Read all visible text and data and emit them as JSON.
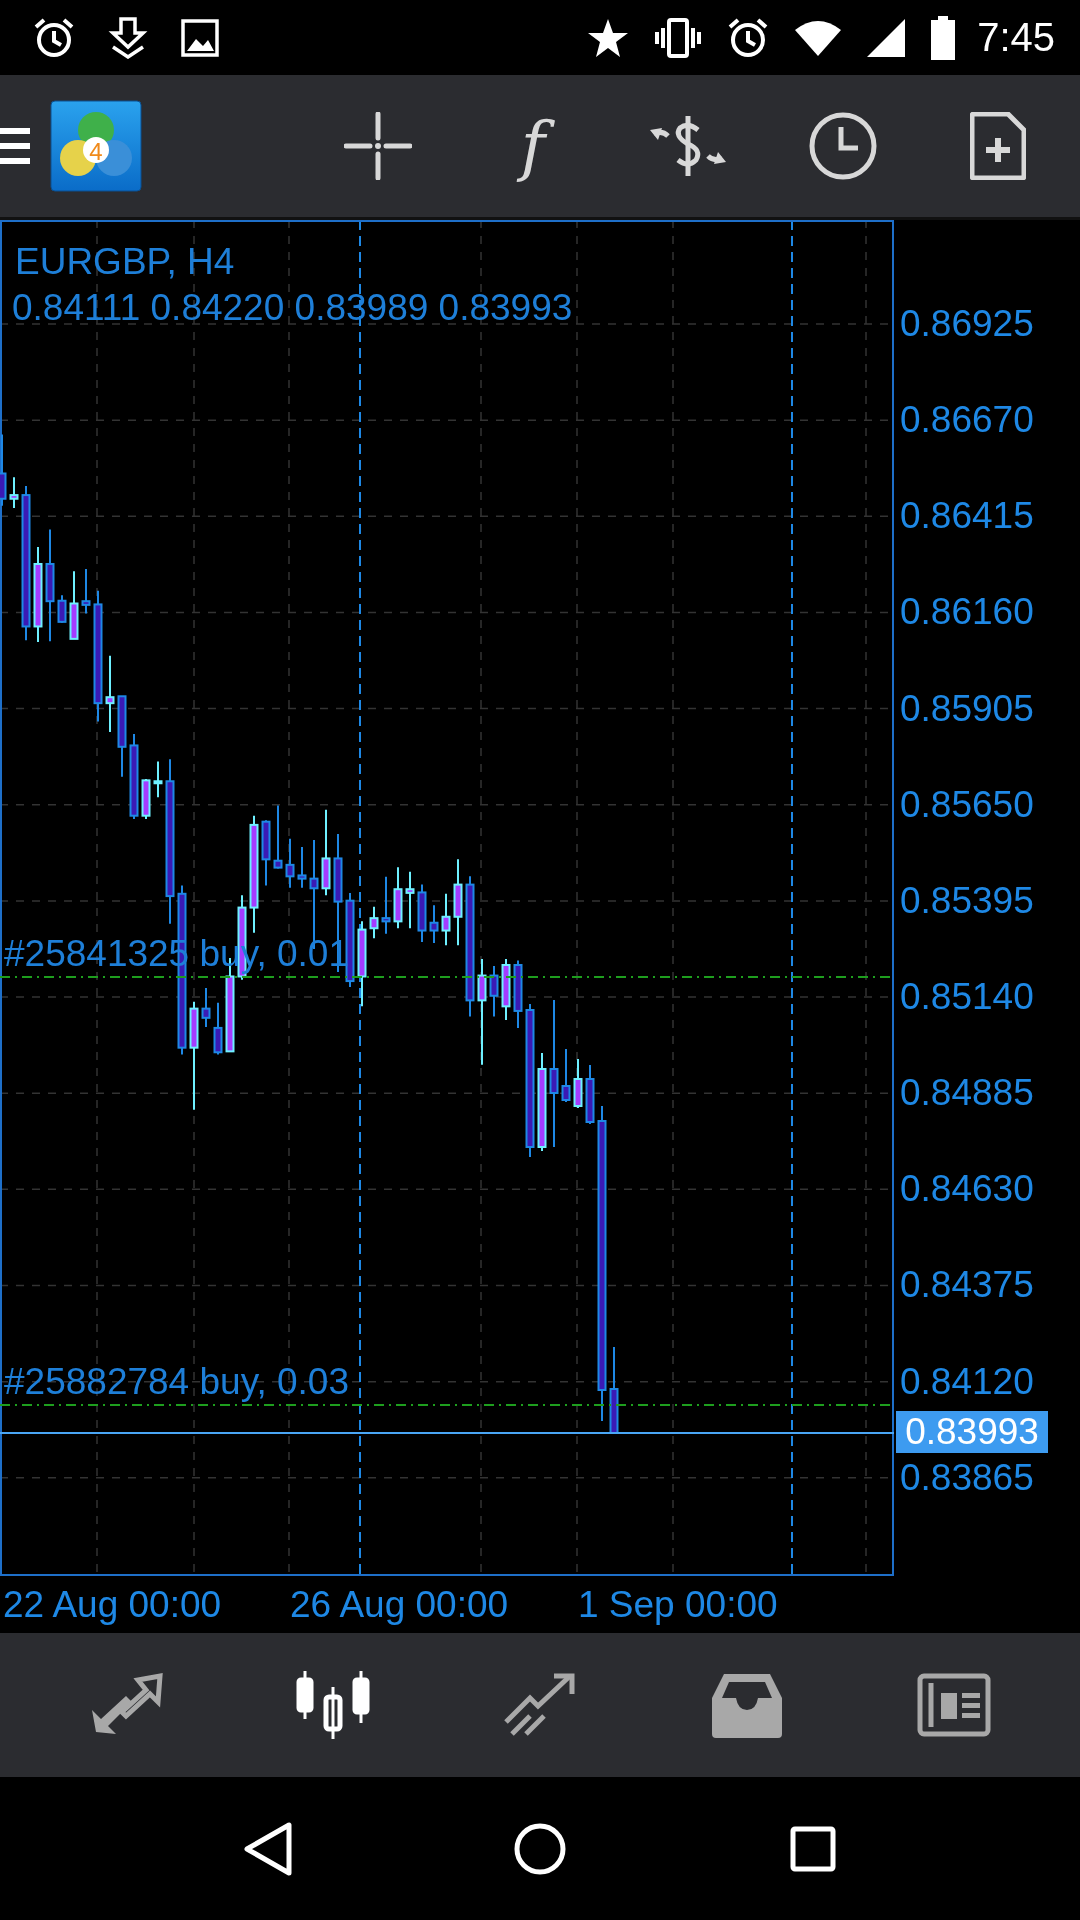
{
  "status_bar": {
    "time": "7:45"
  },
  "toolbar": {
    "logo_badge": "4",
    "function_glyph": "f"
  },
  "chart": {
    "symbol": "EURGBP, H4",
    "ohlc": "0.84111 0.84220 0.83989 0.83993",
    "orders": [
      {
        "label": "#25841325 buy, 0.01"
      },
      {
        "label": "#25882784 buy, 0.03"
      }
    ],
    "price_labels": [
      "0.86925",
      "0.86670",
      "0.86415",
      "0.86160",
      "0.85905",
      "0.85650",
      "0.85395",
      "0.85140",
      "0.84885",
      "0.84630",
      "0.84375",
      "0.84120",
      "0.83865"
    ],
    "current_price": "0.83993",
    "date_labels": [
      "22 Aug 00:00",
      "26 Aug 00:00",
      "1 Sep 00:00"
    ]
  },
  "bottom_nav": [
    {
      "kind": "trade",
      "selected": false
    },
    {
      "kind": "chart",
      "selected": true
    },
    {
      "kind": "history",
      "selected": false
    },
    {
      "kind": "inbox",
      "selected": false
    },
    {
      "kind": "news",
      "selected": false
    }
  ]
}
